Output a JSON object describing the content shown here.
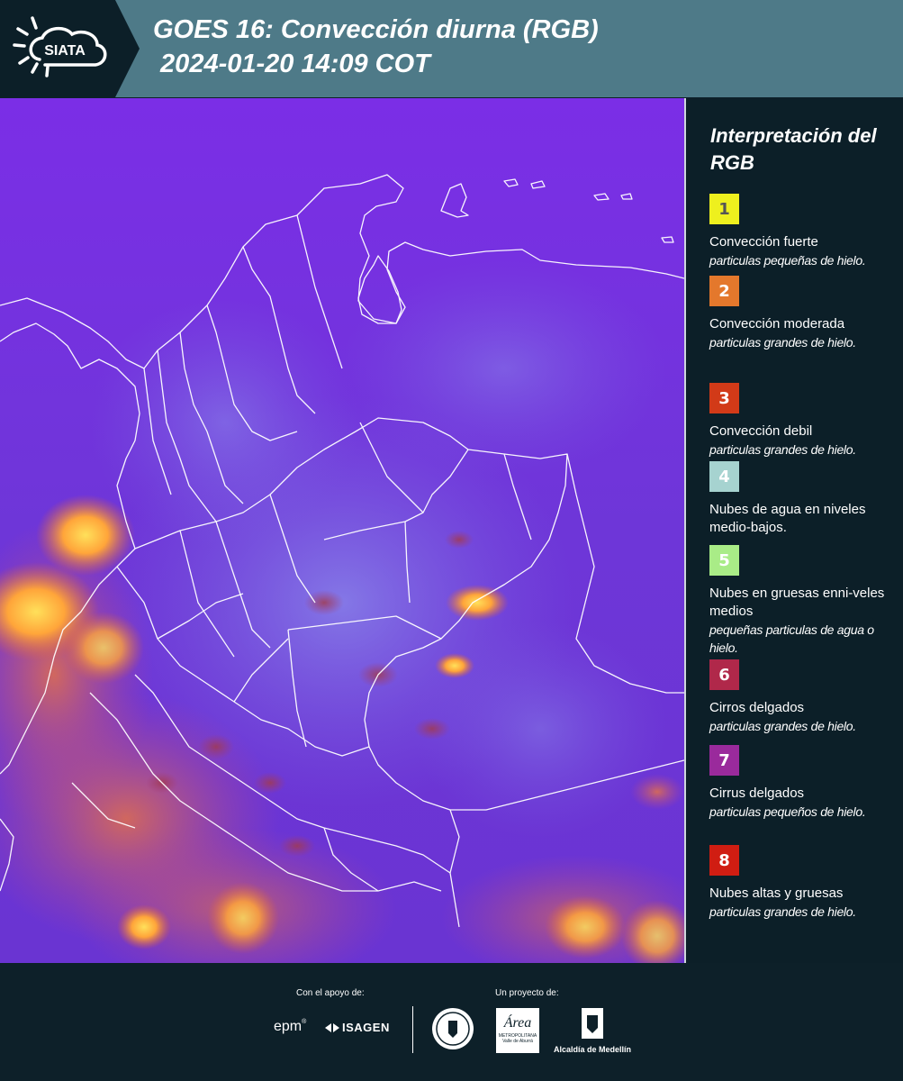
{
  "header": {
    "logo_text": "SIATA",
    "title_line1": "GOES 16: Convección diurna (RGB)",
    "title_line2": " 2024-01-20 14:09 COT",
    "background_color": "#4e7a88"
  },
  "map": {
    "base_color": "#7a2fe0",
    "border_color": "#ffffff"
  },
  "legend": {
    "title": "Interpretación del RGB",
    "items": [
      {
        "num": "1",
        "color": "#eef01e",
        "num_color": "#555555",
        "label": "Convección fuerte",
        "sub": "particulas pequeñas de hielo."
      },
      {
        "num": "2",
        "color": "#e4782c",
        "num_color": "#ffffff",
        "label": "Convección moderada",
        "sub": "particulas grandes de hielo."
      },
      {
        "num": "3",
        "color": "#d23a18",
        "num_color": "#ffffff",
        "label": "Convección debil",
        "sub": "particulas grandes de hielo."
      },
      {
        "num": "4",
        "color": "#a6d3d0",
        "num_color": "#ffffff",
        "label": "Nubes de agua en niveles medio-bajos.",
        "sub": ""
      },
      {
        "num": "5",
        "color": "#a9ec87",
        "num_color": "#ffffff",
        "label": "Nubes en gruesas enni-veles medios",
        "sub": "pequeñas particulas de agua o hielo."
      },
      {
        "num": "6",
        "color": "#b0284a",
        "num_color": "#ffffff",
        "label": "Cirros delgados",
        "sub": "particulas grandes de hielo."
      },
      {
        "num": "7",
        "color": "#9a2a9c",
        "num_color": "#ffffff",
        "label": "Cirrus delgados",
        "sub": "particulas pequeños de hielo."
      },
      {
        "num": "8",
        "color": "#d01d12",
        "num_color": "#ffffff",
        "label": "Nubes altas y gruesas",
        "sub": "particulas grandes de hielo."
      }
    ]
  },
  "footer": {
    "support_label": "Con el apoyo de:",
    "sponsor1": "epm",
    "sponsor2": "ISAGEN",
    "project_label": "Un proyecto de:",
    "org_area": "Área",
    "org_area_sub": "METROPOLITANA Valle de Aburrá",
    "org_alcaldia": "Alcaldía de Medellín"
  }
}
